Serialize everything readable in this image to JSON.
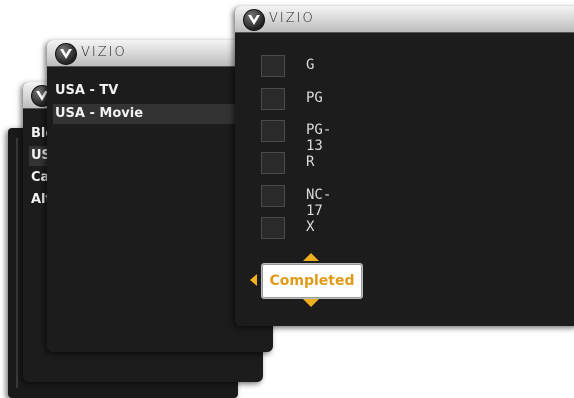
{
  "brand": "VIZIO",
  "panel_back": {
    "items": [
      "Blo",
      "US",
      "Car",
      "Alt"
    ]
  },
  "panel_middle": {
    "items": [
      "USA - TV",
      "USA - Movie"
    ]
  },
  "panel_front": {
    "ratings": [
      "G",
      "PG",
      "PG-13",
      "R",
      "NC-17",
      "X"
    ],
    "completed_label": "Completed"
  },
  "colors": {
    "accent": "#e19a18",
    "panel_bg": "#1c1c1c",
    "titlebar": "#d8d8d8"
  }
}
